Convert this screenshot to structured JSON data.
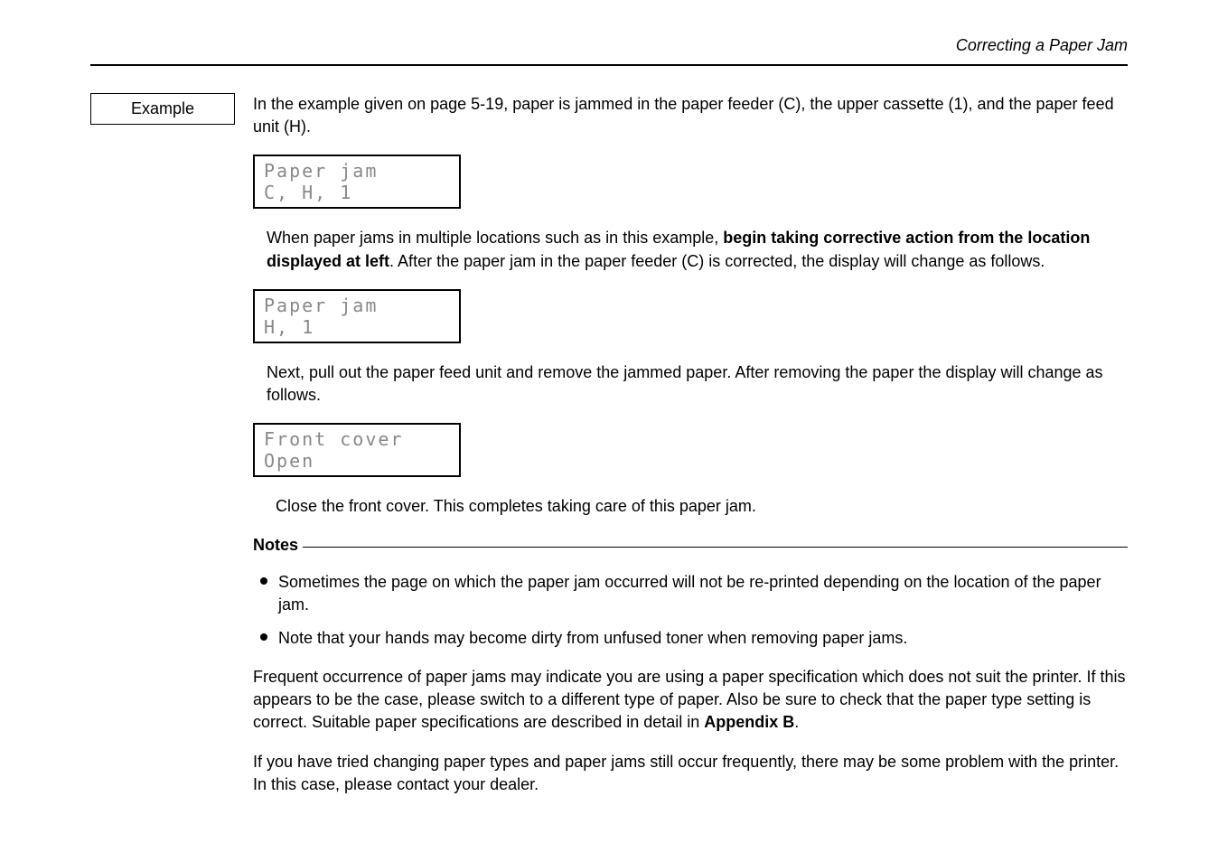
{
  "header": {
    "title": "Correcting a Paper Jam"
  },
  "example_label": "Example",
  "para1": "In the example given on page 5-19, paper is jammed in the paper feeder (C), the upper cassette (1), and the paper feed unit (H).",
  "lcd1": {
    "line1": "Paper jam",
    "line2": "C, H, 1"
  },
  "para2_pre": "When paper jams in multiple locations such as in this example, ",
  "para2_bold": "begin taking corrective action from the location displayed at left",
  "para2_post": ".  After the paper jam in the paper feeder (C) is corrected, the display will change as follows.",
  "lcd2": {
    "line1": "Paper jam",
    "line2": "H, 1"
  },
  "para3": "Next, pull out the paper feed unit and remove the jammed paper.  After removing the paper the display will change as follows.",
  "lcd3": {
    "line1": "Front cover",
    "line2": "Open"
  },
  "para4": "Close the front cover.  This completes taking care of this paper jam.",
  "notes_label": "Notes",
  "bullet1": "Sometimes the page on which the paper jam occurred will not be re-printed depending on the location of the paper jam.",
  "bullet2": "Note that your hands may become dirty from unfused toner when removing paper jams.",
  "para5_pre": "Frequent occurrence of paper jams may indicate you are using a paper specification which does not suit the printer.  If this appears to be the case, please switch to a different type of paper.  Also be sure to  check that the paper type setting is correct.  Suitable paper specifications are described in detail in ",
  "para5_bold": "Appendix B",
  "para5_post": ".",
  "para6": "If you have tried changing paper types and paper jams still occur frequently, there may be some problem with the printer.  In this case, please contact your dealer."
}
